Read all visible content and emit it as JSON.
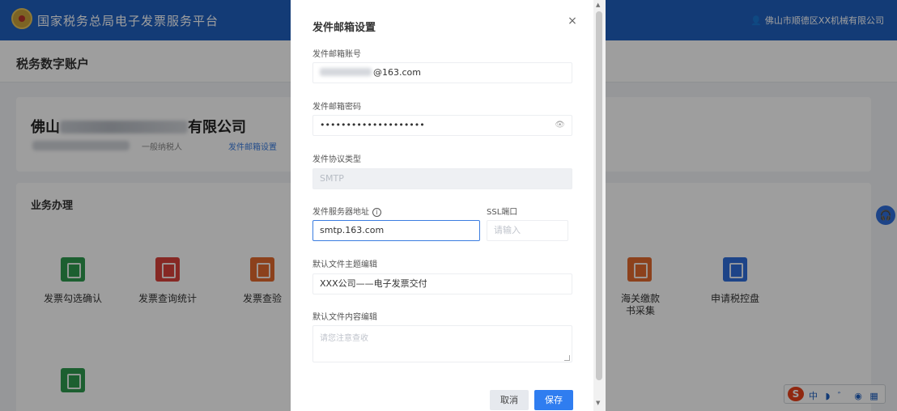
{
  "header": {
    "site_title": "国家税务总局电子发票服务平台",
    "user_text": "佛山市顺德区XX机械有限公司"
  },
  "page": {
    "title": "税务数字账户"
  },
  "company": {
    "name_prefix": "佛山",
    "name_suffix": "有限公司",
    "taxpayer_type": "一般纳税人",
    "mail_settings_link": "发件邮箱设置"
  },
  "business": {
    "title": "业务办理",
    "tiles": [
      {
        "label": "发票勾选确认",
        "color": "#2e9a4e"
      },
      {
        "label": "发票查询统计",
        "color": "#d9413a"
      },
      {
        "label": "发票查验",
        "color": "#e2692e"
      },
      {
        "label": "海关缴款书采集",
        "color": "#e2692e"
      },
      {
        "label": "申请税控盘",
        "color": "#2f6fdb"
      },
      {
        "label": "",
        "color": "#2e9a4e"
      }
    ]
  },
  "ime": {
    "logo": "S",
    "status": "中 ◗ ゛ ◉ ▦"
  },
  "dialog": {
    "title": "发件邮箱设置",
    "close": "×",
    "fields": {
      "email_account": {
        "label": "发件邮箱账号",
        "value": "@163.com"
      },
      "email_password": {
        "label": "发件邮箱密码",
        "value": "••••••••••••••••••••",
        "eye": "👁"
      },
      "protocol_type": {
        "label": "发件协议类型",
        "value": "SMTP"
      },
      "server_address": {
        "label": "发件服务器地址",
        "value": "smtp.163.com"
      },
      "ssl_port": {
        "label": "SSL端口",
        "placeholder": "请输入"
      },
      "default_subject": {
        "label": "默认文件主题编辑",
        "value": "XXX公司——电子发票交付"
      },
      "default_content": {
        "label": "默认文件内容编辑",
        "placeholder": "请您注意查收"
      }
    },
    "buttons": {
      "cancel": "取消",
      "save": "保存"
    }
  },
  "colors": {
    "brand_blue": "#1f5fbf",
    "primary_button": "#2f7df0"
  }
}
